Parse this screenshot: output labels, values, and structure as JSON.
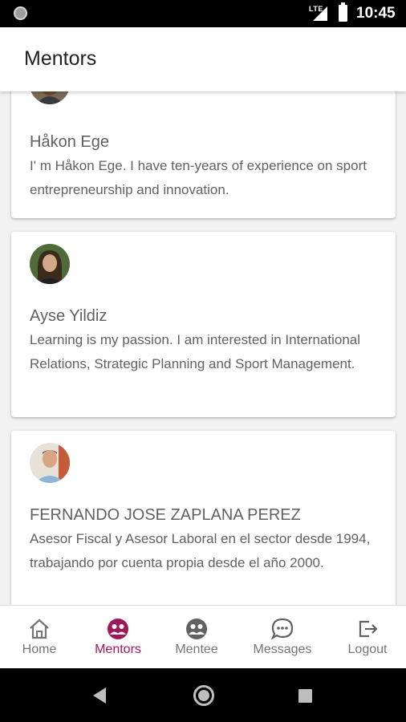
{
  "status_bar": {
    "network": "LTE",
    "time": "10:45"
  },
  "app_bar": {
    "title": "Mentors"
  },
  "mentors": [
    {
      "name": "Håkon Ege",
      "bio": "I' m Håkon Ege. I have ten-years of experience on sport entrepreneurship and innovation."
    },
    {
      "name": "Ayse Yildiz",
      "bio": "Learning is my passion. I am interested in International Relations, Strategic Planning and Sport Management."
    },
    {
      "name": "FERNANDO JOSE ZAPLANA PEREZ",
      "bio": "Asesor Fiscal y Asesor Laboral en el sector desde 1994, trabajando por cuenta propia desde el año 2000."
    }
  ],
  "bottom_nav": {
    "items": [
      {
        "label": "Home",
        "icon": "home-icon",
        "active": false
      },
      {
        "label": "Mentors",
        "icon": "mentors-icon",
        "active": true
      },
      {
        "label": "Mentee",
        "icon": "mentee-icon",
        "active": false
      },
      {
        "label": "Messages",
        "icon": "chat-icon",
        "active": false
      },
      {
        "label": "Logout",
        "icon": "logout-icon",
        "active": false
      }
    ]
  },
  "colors": {
    "accent": "#a0185a",
    "text": "#616161",
    "nav_inactive": "#757575"
  }
}
